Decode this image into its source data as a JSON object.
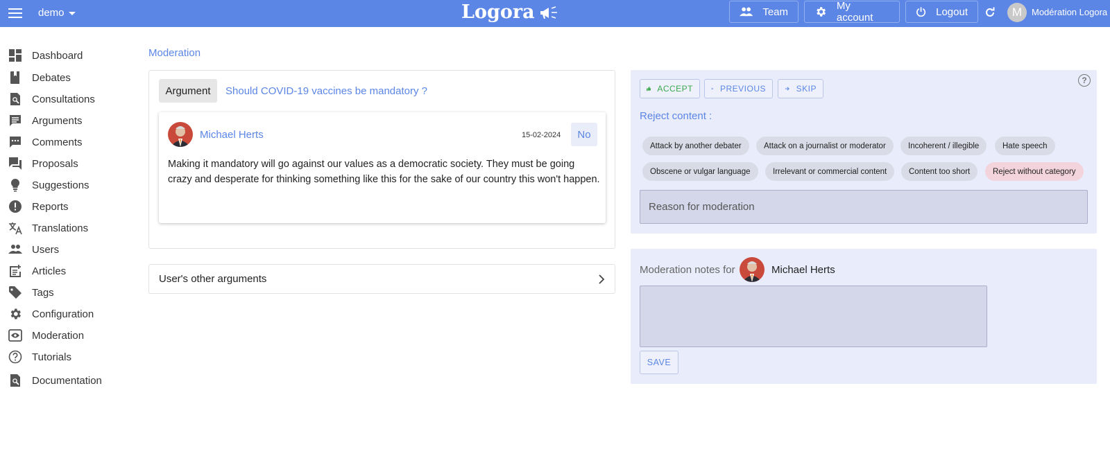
{
  "topbar": {
    "workspace": "demo",
    "logo": "Logora",
    "team_label": "Team",
    "account_label": "My account",
    "logout_label": "Logout",
    "user_initial": "M",
    "user_name": "Modération Logora"
  },
  "sidebar": {
    "items": [
      {
        "label": "Dashboard",
        "icon": "dashboard-icon"
      },
      {
        "label": "Debates",
        "icon": "book-icon"
      },
      {
        "label": "Consultations",
        "icon": "document-search-icon"
      },
      {
        "label": "Arguments",
        "icon": "message-icon"
      },
      {
        "label": "Comments",
        "icon": "comment-icon"
      },
      {
        "label": "Proposals",
        "icon": "forum-icon"
      },
      {
        "label": "Suggestions",
        "icon": "lightbulb-icon"
      },
      {
        "label": "Reports",
        "icon": "alert-icon"
      },
      {
        "label": "Translations",
        "icon": "translate-icon"
      },
      {
        "label": "Users",
        "icon": "users-icon"
      },
      {
        "label": "Articles",
        "icon": "article-add-icon"
      },
      {
        "label": "Tags",
        "icon": "tag-icon"
      },
      {
        "label": "Configuration",
        "icon": "gear-icon"
      },
      {
        "label": "Moderation",
        "icon": "eye-icon"
      },
      {
        "label": "Tutorials",
        "icon": "help-circle-icon"
      },
      {
        "label": "Documentation",
        "icon": "document-search-icon"
      }
    ]
  },
  "breadcrumb": "Moderation",
  "argument": {
    "type_label": "Argument",
    "debate_title": "Should COVID-19 vaccines be mandatory ?",
    "author": "Michael Herts",
    "date": "15-02-2024",
    "position": "No",
    "content": "Making it mandatory will go against our values as a democratic society. They must be going crazy and desperate for thinking something like this for the sake of our country this won't happen."
  },
  "other_arguments_label": "User's other arguments",
  "actions": {
    "accept": "ACCEPT",
    "previous": "PREVIOUS",
    "skip": "SKIP",
    "help": "?"
  },
  "reject": {
    "label": "Reject content :",
    "chips": [
      "Attack by another debater",
      "Attack on a journalist or moderator",
      "Incoherent / illegible",
      "Hate speech",
      "Obscene or vulgar language",
      "Irrelevant or commercial content",
      "Content too short",
      "Reject without category"
    ],
    "reason_placeholder": "Reason for moderation"
  },
  "notes": {
    "label": "Moderation notes for",
    "user": "Michael Herts",
    "save": "SAVE"
  },
  "colors": {
    "primary": "#5b86e5",
    "accept": "#3aa84c",
    "panel": "#e9ecfb",
    "reject_chip": "#f3d3dc"
  }
}
